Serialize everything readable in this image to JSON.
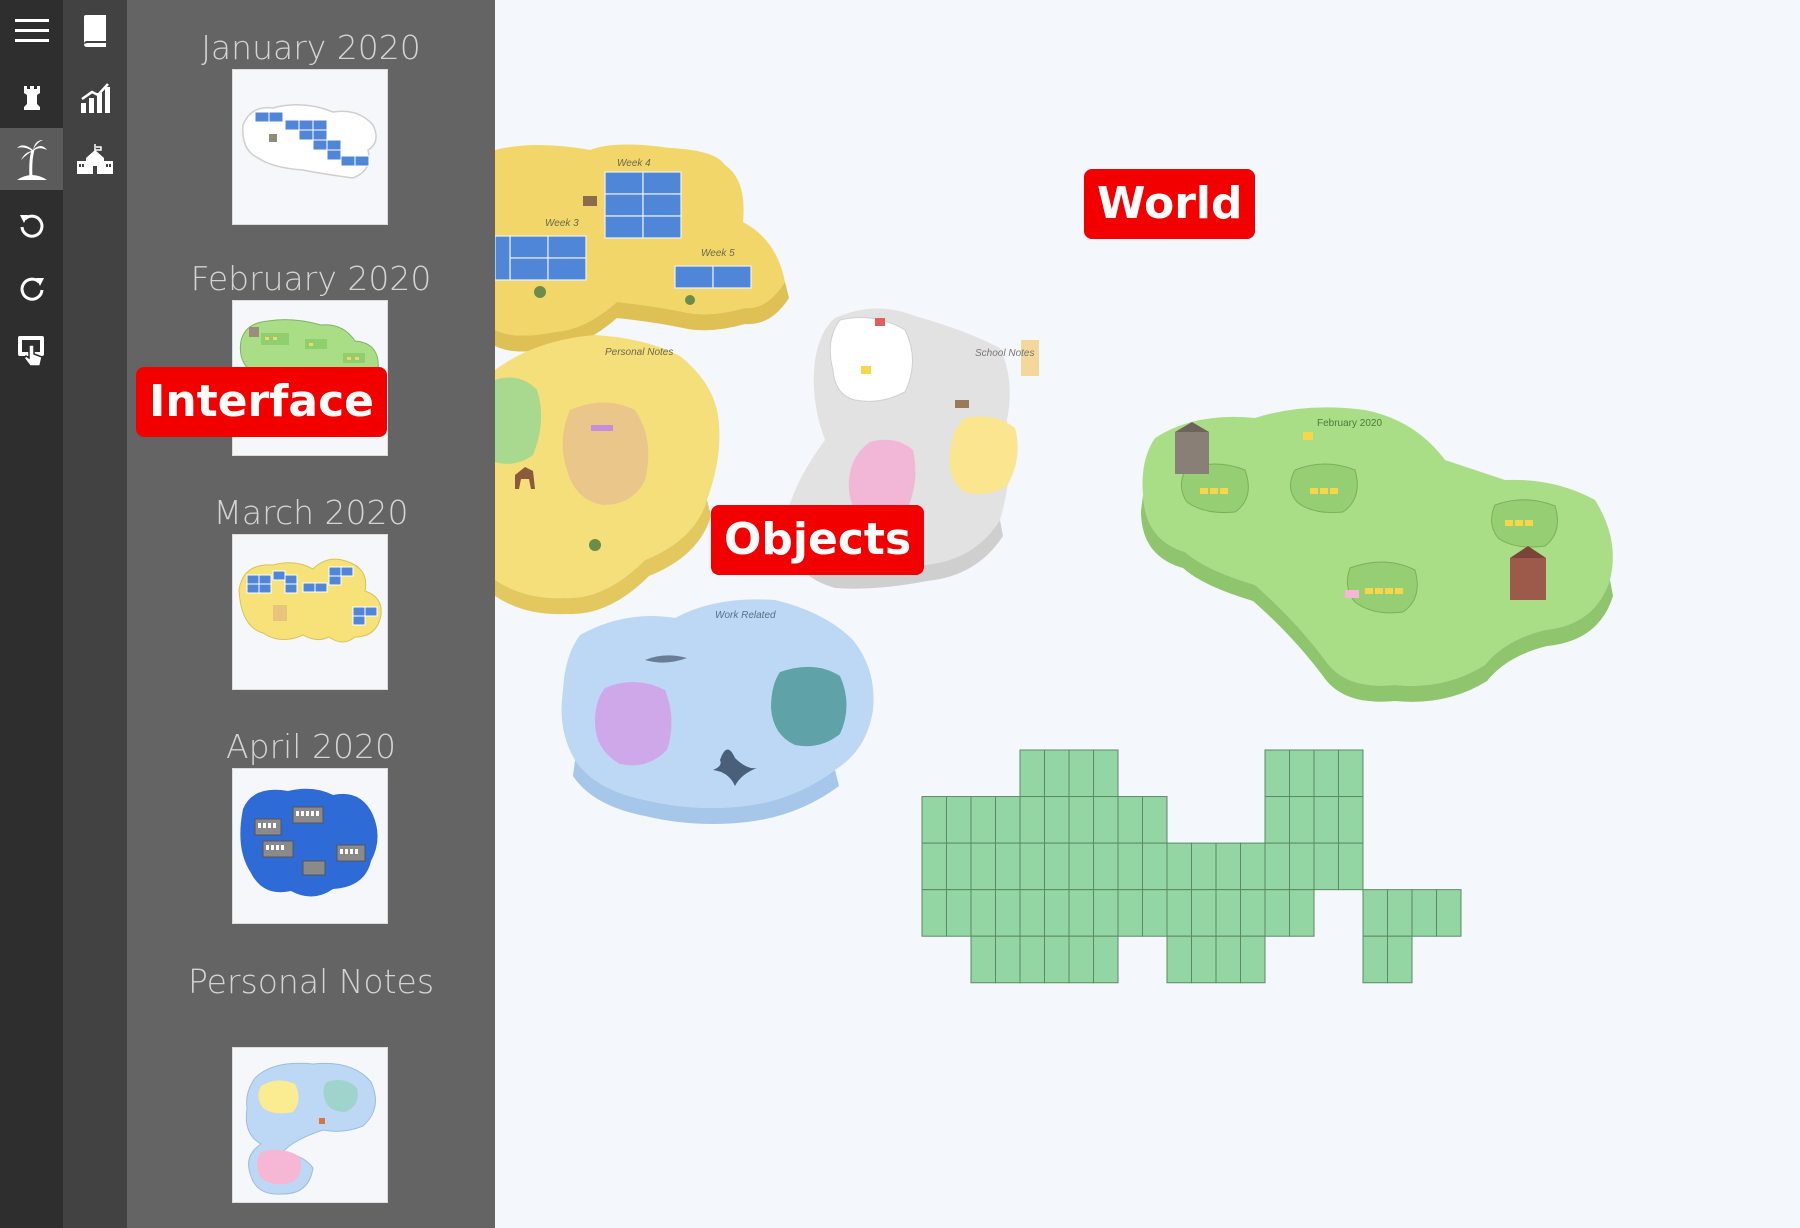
{
  "app": {
    "toolbar_primary": [
      {
        "icon": "menu-icon"
      },
      {
        "icon": "rook-icon"
      },
      {
        "icon": "island-icon",
        "active": true
      },
      {
        "icon": "undo-icon"
      },
      {
        "icon": "redo-icon"
      },
      {
        "icon": "touch-screen-icon"
      }
    ],
    "toolbar_secondary": [
      {
        "icon": "book-icon"
      },
      {
        "icon": "stats-chart-icon"
      },
      {
        "icon": "school-building-icon"
      }
    ]
  },
  "sidebar": {
    "islands": [
      {
        "title": "January 2020"
      },
      {
        "title": "February 2020"
      },
      {
        "title": "March 2020"
      },
      {
        "title": "April 2020"
      },
      {
        "title": "Personal Notes"
      }
    ]
  },
  "world": {
    "island_labels": {
      "week4": "Week 4",
      "week3": "Week 3",
      "week5": "Week 5",
      "personal_notes": "Personal Notes",
      "school_notes": "School Notes",
      "work_related": "Work Related",
      "february": "February 2020"
    }
  },
  "annotations": {
    "world": "World",
    "interface": "Interface",
    "objects": "Objects"
  },
  "colors": {
    "accent_red": "#f20000",
    "yellow_island": "#f7e27a",
    "green_island": "#a9dd86",
    "blue_island": "#bcd8f5",
    "grey_island": "#e4e4e4",
    "grid_green": "#93d6a3"
  }
}
